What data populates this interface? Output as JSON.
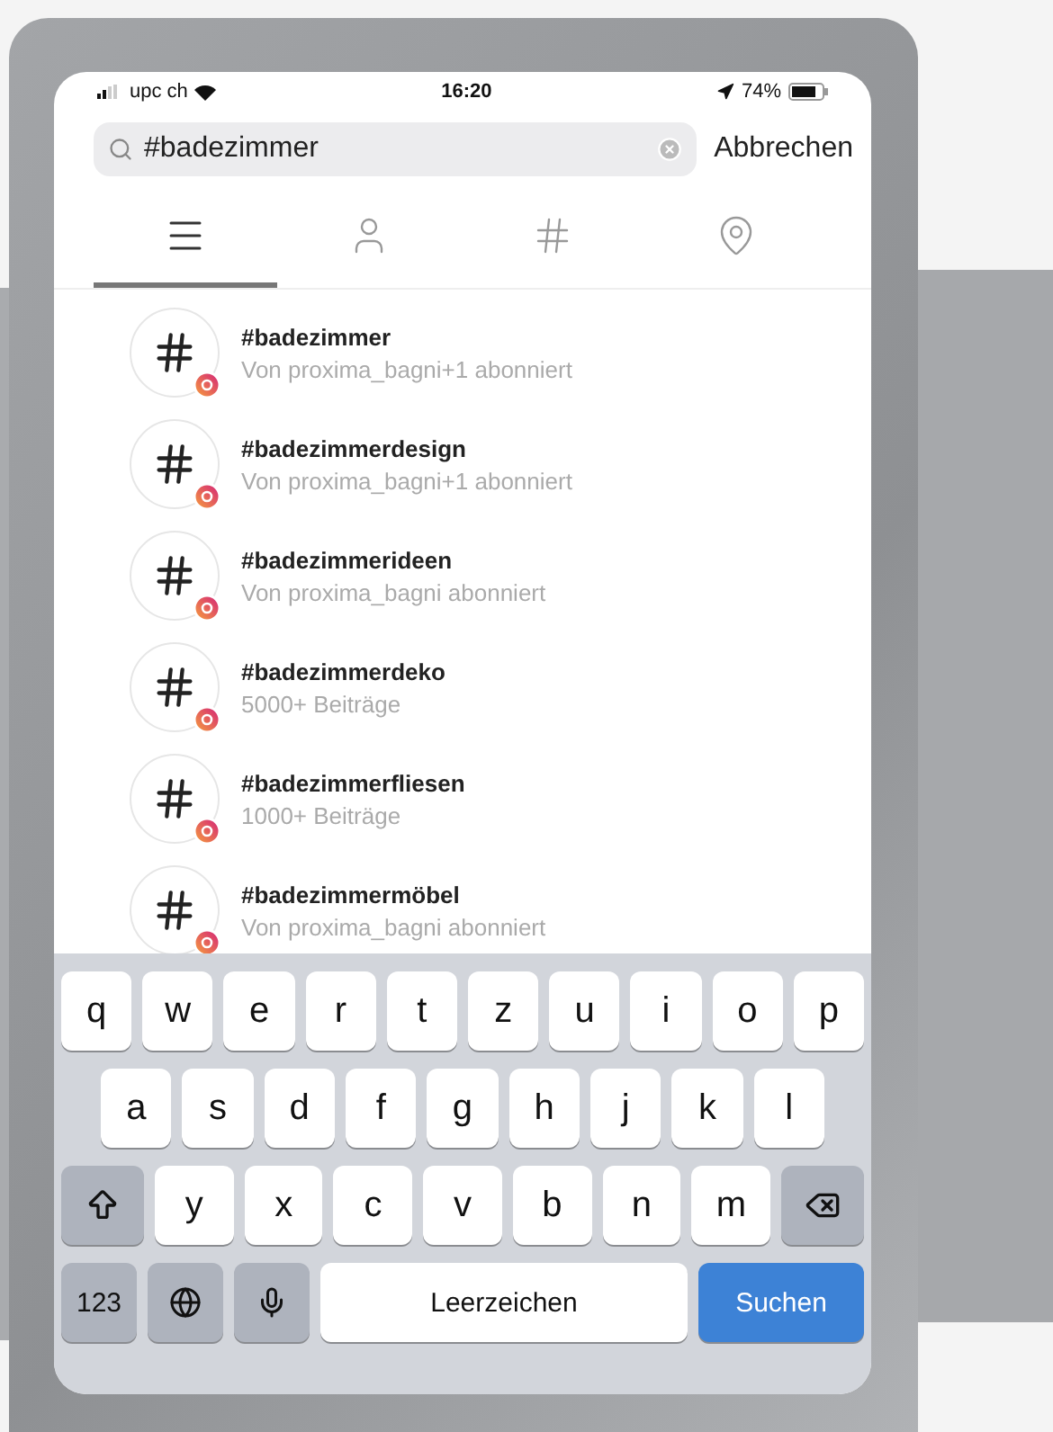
{
  "status_bar": {
    "carrier": "upc ch",
    "time": "16:20",
    "battery": "74%"
  },
  "search": {
    "value": "#badezimmer",
    "cancel": "Abbrechen"
  },
  "tabs": [
    {
      "kind": "list",
      "selected": true
    },
    {
      "kind": "person",
      "selected": false
    },
    {
      "kind": "hashtag",
      "selected": false
    },
    {
      "kind": "place",
      "selected": false
    }
  ],
  "results": [
    {
      "title": "#badezimmer",
      "subtitle": "Von proxima_bagni+1 abonniert"
    },
    {
      "title": "#badezimmerdesign",
      "subtitle": "Von proxima_bagni+1 abonniert"
    },
    {
      "title": "#badezimmerideen",
      "subtitle": "Von proxima_bagni abonniert"
    },
    {
      "title": "#badezimmerdeko",
      "subtitle": "5000+ Beiträge"
    },
    {
      "title": "#badezimmerfliesen",
      "subtitle": "1000+ Beiträge"
    },
    {
      "title": "#badezimmermöbel",
      "subtitle": "Von proxima_bagni abonniert"
    }
  ],
  "keyboard": {
    "rows": [
      {
        "keys": [
          {
            "kind": "letter",
            "label": "q"
          },
          {
            "kind": "letter",
            "label": "w"
          },
          {
            "kind": "letter",
            "label": "e"
          },
          {
            "kind": "letter",
            "label": "r"
          },
          {
            "kind": "letter",
            "label": "t"
          },
          {
            "kind": "letter",
            "label": "z"
          },
          {
            "kind": "letter",
            "label": "u"
          },
          {
            "kind": "letter",
            "label": "i"
          },
          {
            "kind": "letter",
            "label": "o"
          },
          {
            "kind": "letter",
            "label": "p"
          }
        ]
      },
      {
        "keys": [
          {
            "kind": "letter",
            "label": "a"
          },
          {
            "kind": "letter",
            "label": "s"
          },
          {
            "kind": "letter",
            "label": "d"
          },
          {
            "kind": "letter",
            "label": "f"
          },
          {
            "kind": "letter",
            "label": "g"
          },
          {
            "kind": "letter",
            "label": "h"
          },
          {
            "kind": "letter",
            "label": "j"
          },
          {
            "kind": "letter",
            "label": "k"
          },
          {
            "kind": "letter",
            "label": "l"
          }
        ]
      },
      {
        "keys": [
          {
            "kind": "shift"
          },
          {
            "kind": "letter",
            "label": "y"
          },
          {
            "kind": "letter",
            "label": "x"
          },
          {
            "kind": "letter",
            "label": "c"
          },
          {
            "kind": "letter",
            "label": "v"
          },
          {
            "kind": "letter",
            "label": "b"
          },
          {
            "kind": "letter",
            "label": "n"
          },
          {
            "kind": "letter",
            "label": "m"
          },
          {
            "kind": "backspace"
          }
        ]
      },
      {
        "keys": [
          {
            "kind": "numbers",
            "label": "123"
          },
          {
            "kind": "globe"
          },
          {
            "kind": "mic"
          },
          {
            "kind": "space",
            "label": "Leerzeichen"
          },
          {
            "kind": "go",
            "label": "Suchen"
          }
        ]
      }
    ]
  }
}
